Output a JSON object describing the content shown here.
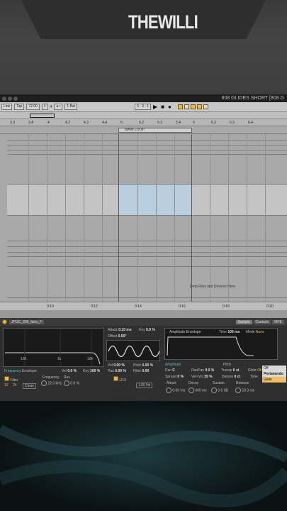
{
  "brand": {
    "logo_text": "THEWILLI"
  },
  "window": {
    "title": "808 GLIDES SHORT  [808 G"
  },
  "controlbar": {
    "link": "Link",
    "tap": "Tap",
    "tempo": "72.00",
    "signature_num": "4",
    "signature_den": "4",
    "quantize": "1 Bar",
    "position": "5 .  3 .  1"
  },
  "ruler": {
    "ticks": [
      "3.3",
      "3.4",
      "4",
      "4.2",
      "4.3",
      "4.4",
      "5",
      "5.2",
      "5.3",
      "5.4",
      "6",
      "6.2",
      "6.3",
      "6.4"
    ]
  },
  "loop": {
    "label": "MAIN LOOP"
  },
  "arrangement": {
    "drop_hint": "Drop Files and Devices Here"
  },
  "time_ruler": {
    "ticks": [
      "0:10",
      "0:12",
      "0:14",
      "0:16",
      "0:18",
      "0:20"
    ]
  },
  "device": {
    "name": "JPGC_808_farts_F",
    "tabs": [
      "Sample",
      "Controls",
      "MPE"
    ],
    "filter": {
      "freq_ticks": [
        "100",
        "1k",
        "10k"
      ],
      "frequency_label": "Frequency",
      "envelope_label": "Envelope",
      "vel_label": "Vel",
      "vel_value": "0.0 %",
      "key_label": "Key",
      "key_value": "100 %",
      "filter_label": "Filter",
      "type_value": "Clean",
      "slope_12": "12",
      "slope_24": "24",
      "frequency_value": "22.0 kHz",
      "res_label": "Res",
      "res_value": "0.0 %"
    },
    "osc": {
      "attack_label": "Attack",
      "attack_value": "0.10 ms",
      "key_label": "Key",
      "key_value": "0.0 %",
      "offset_label": "Offset",
      "offset_value": "0.00°",
      "vol_label": "Vol",
      "vol_value": "0.00 %",
      "pitch_label": "Pitch",
      "pitch_value": "0.00 %",
      "pan_label": "Pan",
      "pan_value": "0.00 %",
      "filter_label": "Filter",
      "filter_value": "0.00",
      "lfo_label": "LFO",
      "lfo_rate": "1.00 Hz"
    },
    "amp": {
      "title": "Amplitude Envelope",
      "time_label": "Time",
      "time_value": "100 ms",
      "mode_label": "Mode",
      "mode_value": "None",
      "amplitude_label": "Amplitude",
      "pitch_label": "Pitch",
      "pan_label": "Pan",
      "pan_value": "C",
      "ranpan_label": "RanPan",
      "ranpan_value": "0.0 %",
      "transp_label": "Transp",
      "transp_value": "0 st",
      "glide_label": "Glide",
      "glide_value": "Off",
      "spread_label": "Spread",
      "spread_value": "0 %",
      "velvol_label": "Vel>Vol",
      "velvol_value": "35 %",
      "detune_label": "Detune",
      "detune_value": "0 ct",
      "time2_label": "Time",
      "attack_label": "Attack",
      "attack_value": "0.00 ms",
      "decay_label": "Decay",
      "decay_value": "600 ms",
      "sustain_label": "Sustain",
      "sustain_value": "0.0 dB",
      "release_label": "Release",
      "release_value": "50.0 ms"
    },
    "glide_menu": [
      "Off",
      "Portamento",
      "Glide"
    ]
  }
}
